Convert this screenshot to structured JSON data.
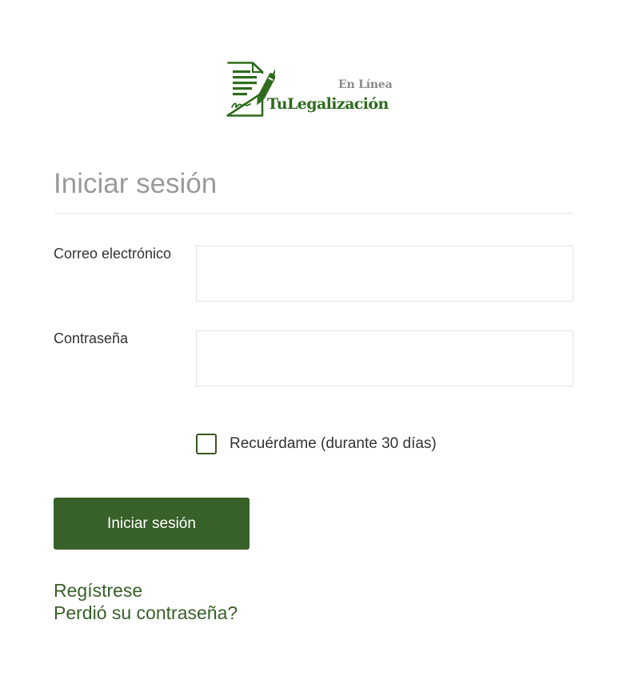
{
  "brand": {
    "tagline": "En Línea",
    "name": "TuLegalización",
    "color": "#2f6b1f",
    "icon": "document-pen-icon"
  },
  "login": {
    "title": "Iniciar sesión",
    "email_label": "Correo electrónico",
    "email_value": "",
    "password_label": "Contraseña",
    "password_value": "",
    "remember_label": "Recuérdame (durante 30 días)",
    "remember_checked": false,
    "submit_label": "Iniciar sesión",
    "accent_color": "#386029"
  },
  "links": {
    "register": "Regístrese",
    "forgot_password": "Perdió su contraseña?"
  }
}
